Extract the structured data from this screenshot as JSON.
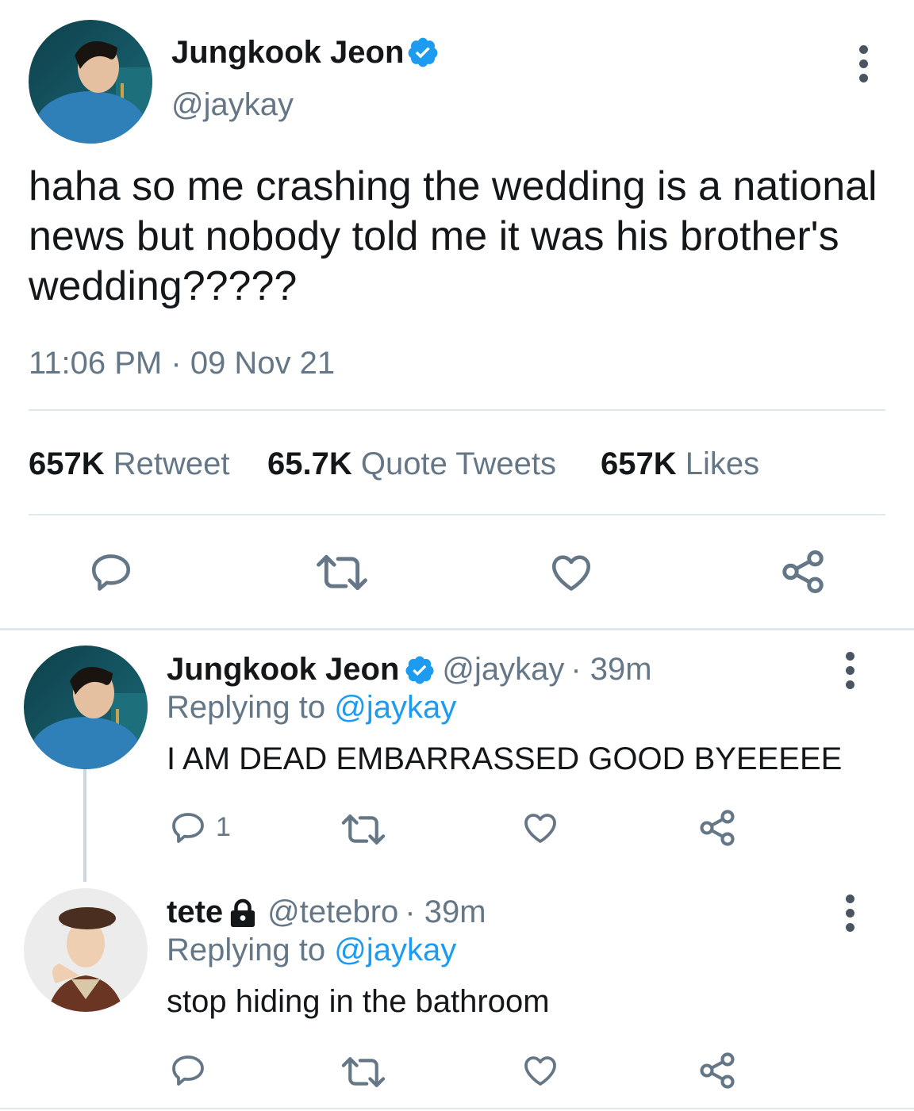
{
  "main_tweet": {
    "author_name": "Jungkook Jeon",
    "author_handle": "@jaykay",
    "text": "haha so me crashing the wedding is a national news but nobody told me it was his brother's wedding?????",
    "time": "11:06 PM",
    "date_sep": "·",
    "date": "09 Nov 21",
    "stats": {
      "retweets_count": "657K",
      "retweets_label": "Retweet",
      "quotes_count": "65.7K",
      "quotes_label": "Quote Tweets",
      "likes_count": "657K",
      "likes_label": "Likes"
    }
  },
  "replies": [
    {
      "author_name": "Jungkook Jeon",
      "author_handle": "@jaykay",
      "time": "· 39m",
      "replying_prefix": "Replying to",
      "replying_handle": "@jaykay",
      "text": "I AM DEAD EMBARRASSED GOOD BYEEEEE",
      "reply_count": "1"
    },
    {
      "author_name": "tete",
      "author_handle": "@tetebro",
      "time": "· 39m",
      "replying_prefix": "Replying to",
      "replying_handle": "@jaykay",
      "text": "stop hiding in the bathroom",
      "reply_count": ""
    }
  ],
  "colors": {
    "verified_blue": "#1d9bf0",
    "secondary_text": "#657786",
    "icon_grey": "#657786",
    "divider": "#e1e8ed"
  },
  "icons": [
    "verified-badge-icon",
    "more-options-icon",
    "reply-icon",
    "retweet-icon",
    "like-icon",
    "share-icon",
    "lock-icon"
  ]
}
